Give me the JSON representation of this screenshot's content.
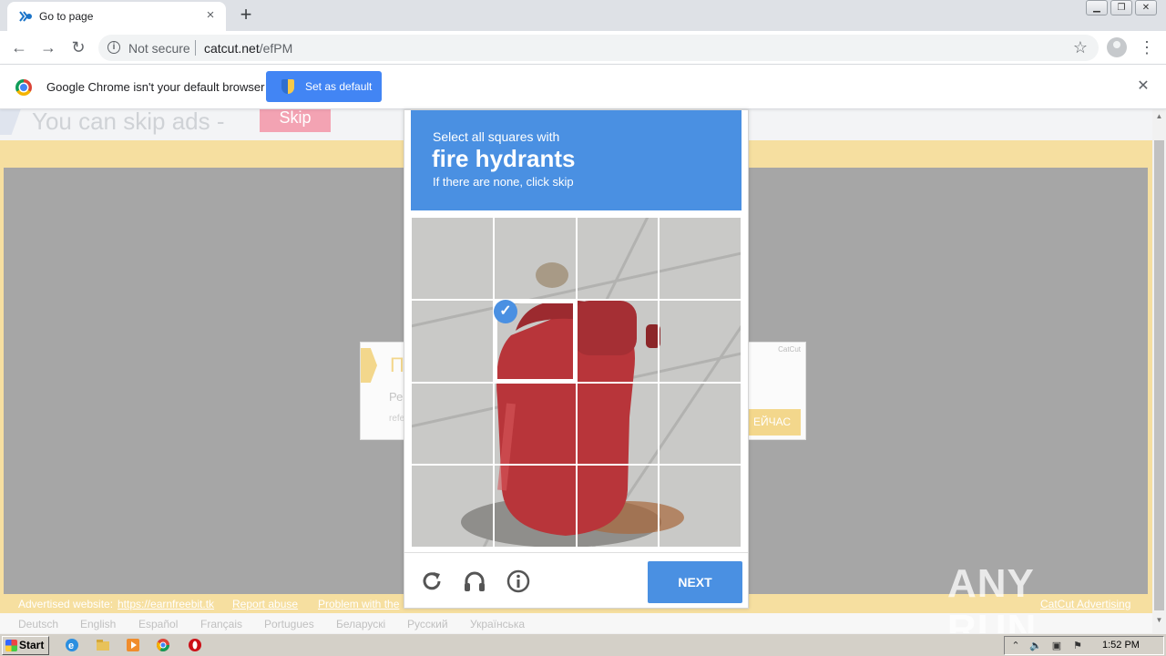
{
  "browser": {
    "tab_title": "Go to page",
    "tab_close": "×",
    "new_tab": "+",
    "address": {
      "security_label": "Not secure",
      "url_host": "catcut.net",
      "url_path": "/efPM"
    },
    "nav": {
      "back": "←",
      "forward": "→",
      "reload": "↻"
    },
    "menu": "⋮",
    "star": "☆"
  },
  "infobar": {
    "message": "Google Chrome isn't your default browser",
    "button": "Set as default",
    "close": "✕"
  },
  "page": {
    "skip_text": "You can skip ads  -",
    "skip_button": "Skip",
    "ad": {
      "heading": "П",
      "line1": "Ре",
      "line2": "refe",
      "brand": "CatCut",
      "cta": "ЕЙЧАС"
    },
    "footer": {
      "advertised_label": "Advertised website:",
      "advertised_link": "https://earnfreebit.tk",
      "report_abuse": "Report abuse",
      "problem": "Problem with the",
      "advertising": "CatCut Advertising"
    },
    "languages": [
      "Deutsch",
      "English",
      "Español",
      "Français",
      "Portugues",
      "Беларускі",
      "Русский",
      "Українська"
    ],
    "watermark": "ANY RUN"
  },
  "captcha": {
    "instruction_line1": "Select all squares with",
    "target": "fire hydrants",
    "instruction_line3": "If there are none, click skip",
    "selected_tiles": [
      5
    ],
    "next_button": "NEXT",
    "check_mark": "✓",
    "icons": [
      "reload-icon",
      "headphones-icon",
      "info-icon"
    ],
    "colors": {
      "accent": "#4a90e2",
      "hydrant": "#b8353a"
    }
  },
  "taskbar": {
    "start": "Start",
    "clock": "1:52 PM"
  }
}
